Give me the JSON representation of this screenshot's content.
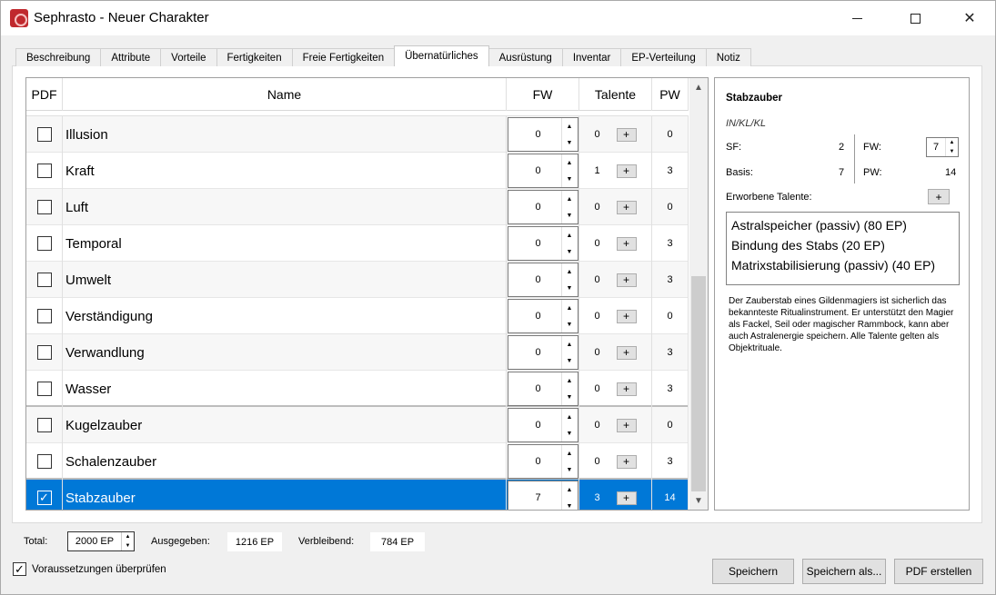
{
  "window": {
    "title": "Sephrasto - Neuer Charakter"
  },
  "tabs": [
    {
      "label": "Beschreibung",
      "active": false
    },
    {
      "label": "Attribute",
      "active": false
    },
    {
      "label": "Vorteile",
      "active": false
    },
    {
      "label": "Fertigkeiten",
      "active": false
    },
    {
      "label": "Freie Fertigkeiten",
      "active": false
    },
    {
      "label": "Übernatürliches",
      "active": true
    },
    {
      "label": "Ausrüstung",
      "active": false
    },
    {
      "label": "Inventar",
      "active": false
    },
    {
      "label": "EP-Verteilung",
      "active": false
    },
    {
      "label": "Notiz",
      "active": false
    }
  ],
  "table": {
    "headers": {
      "pdf": "PDF",
      "name": "Name",
      "fw": "FW",
      "talente": "Talente",
      "pw": "PW"
    },
    "rows": [
      {
        "name": "Illusion",
        "pdf": false,
        "fw": "0",
        "talente": "0",
        "pw": "0"
      },
      {
        "name": "Kraft",
        "pdf": false,
        "fw": "0",
        "talente": "1",
        "pw": "3"
      },
      {
        "name": "Luft",
        "pdf": false,
        "fw": "0",
        "talente": "0",
        "pw": "0"
      },
      {
        "name": "Temporal",
        "pdf": false,
        "fw": "0",
        "talente": "0",
        "pw": "3"
      },
      {
        "name": "Umwelt",
        "pdf": false,
        "fw": "0",
        "talente": "0",
        "pw": "3"
      },
      {
        "name": "Verständigung",
        "pdf": false,
        "fw": "0",
        "talente": "0",
        "pw": "0"
      },
      {
        "name": "Verwandlung",
        "pdf": false,
        "fw": "0",
        "talente": "0",
        "pw": "3"
      },
      {
        "name": "Wasser",
        "pdf": false,
        "fw": "0",
        "talente": "0",
        "pw": "3"
      },
      {
        "name": "Kugelzauber",
        "pdf": false,
        "fw": "0",
        "talente": "0",
        "pw": "0"
      },
      {
        "name": "Schalenzauber",
        "pdf": false,
        "fw": "0",
        "talente": "0",
        "pw": "3"
      },
      {
        "name": "Stabzauber",
        "pdf": true,
        "fw": "7",
        "talente": "3",
        "pw": "14"
      }
    ]
  },
  "detail": {
    "title": "Stabzauber",
    "probe": "IN/KL/KL",
    "sf_label": "SF:",
    "sf_value": "2",
    "fw_label": "FW:",
    "fw_value": "7",
    "basis_label": "Basis:",
    "basis_value": "7",
    "pw_label": "PW:",
    "pw_value": "14",
    "talente_label": "Erworbene Talente:",
    "talente": [
      "Astralspeicher (passiv) (80 EP)",
      "Bindung des Stabs (20 EP)",
      "Matrixstabilisierung (passiv) (40 EP)"
    ],
    "description": "Der Zauberstab eines Gildenmagiers ist sicherlich das bekannteste Ritualinstrument. Er unterstützt den Magier als Fackel, Seil oder magischer Rammbock, kann aber auch Astralenergie speichern. Alle Talente gelten als Objektrituale."
  },
  "bottom": {
    "total_label": "Total:",
    "total_value": "2000 EP",
    "ausgegeben_label": "Ausgegeben:",
    "ausgegeben_value": "1216 EP",
    "verbleibend_label": "Verbleibend:",
    "verbleibend_value": "784 EP",
    "voraussetzungen_label": "Voraussetzungen überprüfen",
    "voraussetzungen_checked": true,
    "save_label": "Speichern",
    "save_as_label": "Speichern als...",
    "pdf_label": "PDF erstellen"
  },
  "icons": {
    "app": "sephrasto-app-icon",
    "minimize": "minimize-icon",
    "maximize": "maximize-icon",
    "close": "close-icon",
    "check": "✓",
    "plus": "+",
    "up": "▲",
    "down": "▼"
  },
  "colors": {
    "selection": "#0078d7",
    "app_icon": "#c0282d"
  }
}
